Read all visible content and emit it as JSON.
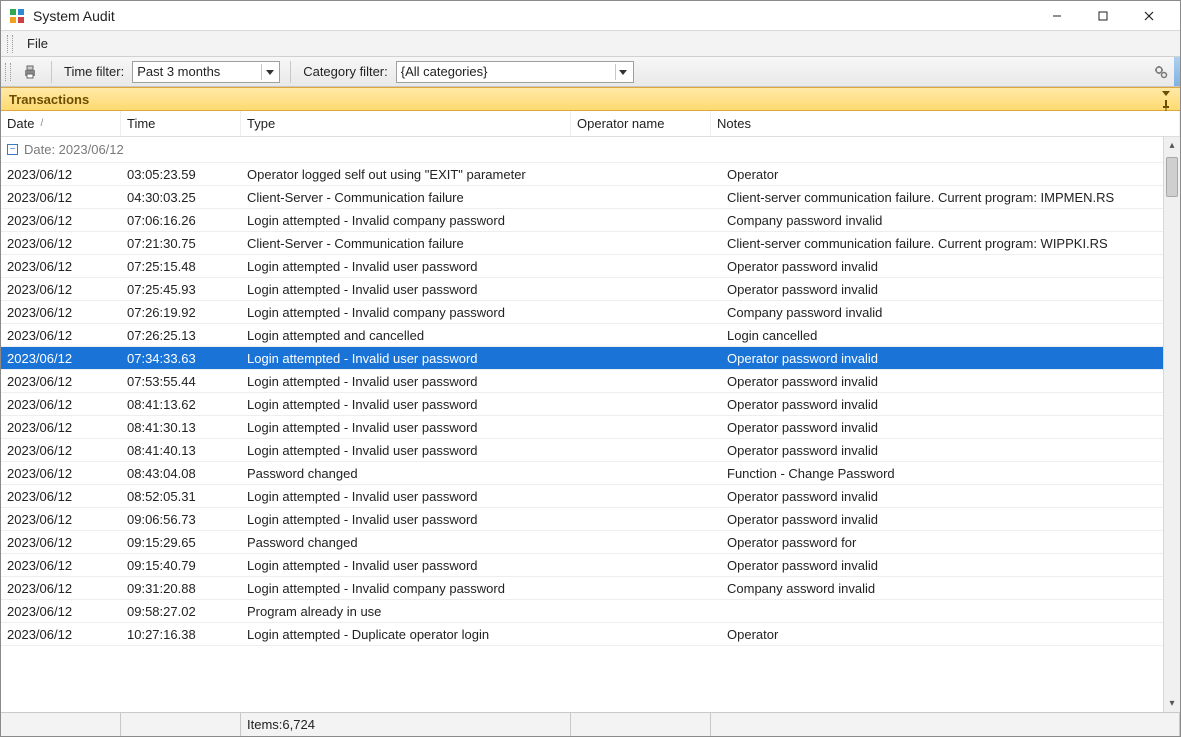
{
  "window": {
    "title": "System Audit"
  },
  "menubar": {
    "file": "File"
  },
  "toolbar": {
    "time_filter_label": "Time filter:",
    "time_filter_value": "Past 3 months",
    "category_filter_label": "Category filter:",
    "category_filter_value": "{All categories}"
  },
  "panel": {
    "title": "Transactions"
  },
  "columns": {
    "date": "Date",
    "time": "Time",
    "type": "Type",
    "operator": "Operator name",
    "notes": "Notes"
  },
  "group": {
    "label": "Date: 2023/06/12"
  },
  "rows": [
    {
      "date": "2023/06/12",
      "time": "03:05:23.59",
      "type": "Operator logged self out using \"EXIT\" parameter",
      "op": "",
      "notes": "Operator"
    },
    {
      "date": "2023/06/12",
      "time": "04:30:03.25",
      "type": "Client-Server - Communication failure",
      "op": "",
      "notes": "Client-server communication failure. Current program: IMPMEN.RS"
    },
    {
      "date": "2023/06/12",
      "time": "07:06:16.26",
      "type": "Login attempted - Invalid company password",
      "op": "",
      "notes": "Company     password invalid"
    },
    {
      "date": "2023/06/12",
      "time": "07:21:30.75",
      "type": "Client-Server - Communication failure",
      "op": "",
      "notes": "Client-server communication failure. Current program: WIPPKI.RS"
    },
    {
      "date": "2023/06/12",
      "time": "07:25:15.48",
      "type": "Login attempted - Invalid user password",
      "op": "",
      "notes": "Operator        password invalid"
    },
    {
      "date": "2023/06/12",
      "time": "07:25:45.93",
      "type": "Login attempted - Invalid user password",
      "op": "",
      "notes": "Operator        password invalid"
    },
    {
      "date": "2023/06/12",
      "time": "07:26:19.92",
      "type": "Login attempted - Invalid company password",
      "op": "",
      "notes": "Company     password invalid"
    },
    {
      "date": "2023/06/12",
      "time": "07:26:25.13",
      "type": "Login attempted and cancelled",
      "op": "",
      "notes": "Login cancelled"
    },
    {
      "date": "2023/06/12",
      "time": "07:34:33.63",
      "type": "Login attempted - Invalid user password",
      "op": "",
      "notes": "Operator        password invalid",
      "selected": true
    },
    {
      "date": "2023/06/12",
      "time": "07:53:55.44",
      "type": "Login attempted - Invalid user password",
      "op": "",
      "notes": "Operator        password invalid"
    },
    {
      "date": "2023/06/12",
      "time": "08:41:13.62",
      "type": "Login attempted - Invalid user password",
      "op": "",
      "notes": "Operator      password invalid"
    },
    {
      "date": "2023/06/12",
      "time": "08:41:30.13",
      "type": "Login attempted - Invalid user password",
      "op": "",
      "notes": "Operator      password invalid"
    },
    {
      "date": "2023/06/12",
      "time": "08:41:40.13",
      "type": "Login attempted - Invalid user password",
      "op": "",
      "notes": "Operator      password invalid"
    },
    {
      "date": "2023/06/12",
      "time": "08:43:04.08",
      "type": "Password changed",
      "op": "",
      "notes": "Function - Change Password"
    },
    {
      "date": "2023/06/12",
      "time": "08:52:05.31",
      "type": "Login attempted - Invalid user password",
      "op": "",
      "notes": "Operator       password invalid"
    },
    {
      "date": "2023/06/12",
      "time": "09:06:56.73",
      "type": "Login attempted - Invalid user password",
      "op": "",
      "notes": "Operator       password invalid"
    },
    {
      "date": "2023/06/12",
      "time": "09:15:29.65",
      "type": "Password changed",
      "op": "",
      "notes": "Operator password for"
    },
    {
      "date": "2023/06/12",
      "time": "09:15:40.79",
      "type": "Login attempted - Invalid user password",
      "op": "",
      "notes": "Operator       password invalid"
    },
    {
      "date": "2023/06/12",
      "time": "09:31:20.88",
      "type": "Login attempted - Invalid company password",
      "op": "",
      "notes": "Company     assword invalid"
    },
    {
      "date": "2023/06/12",
      "time": "09:58:27.02",
      "type": "Program already in use",
      "op": "",
      "notes": ""
    },
    {
      "date": "2023/06/12",
      "time": "10:27:16.38",
      "type": "Login attempted - Duplicate operator login",
      "op": "",
      "notes": "Operator"
    }
  ],
  "status": {
    "items_label": "Items:6,724"
  }
}
